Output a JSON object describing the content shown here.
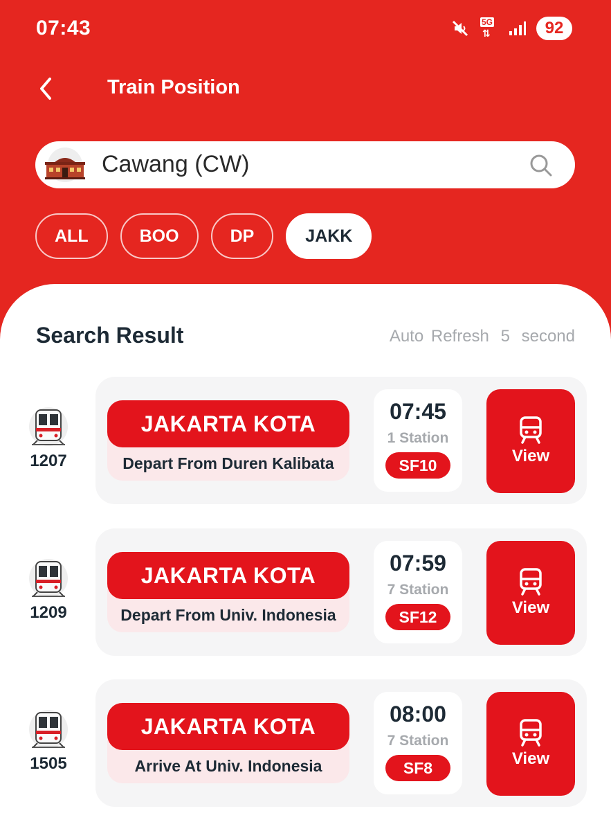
{
  "status_bar": {
    "time": "07:43",
    "network": "5G",
    "battery": "92"
  },
  "header": {
    "title": "Train Position"
  },
  "search": {
    "value": "Cawang (CW)"
  },
  "filters": [
    "ALL",
    "BOO",
    "DP",
    "JAKK"
  ],
  "active_filter": "JAKK",
  "results": {
    "title": "Search Result",
    "auto_refresh_label": "Auto Refresh",
    "auto_refresh_value": "5",
    "auto_refresh_unit": "second",
    "items": [
      {
        "train_no": "1207",
        "destination": "JAKARTA KOTA",
        "info": "Depart From Duren Kalibata",
        "time": "07:45",
        "stations": "1 Station",
        "platform": "SF10",
        "view_label": "View"
      },
      {
        "train_no": "1209",
        "destination": "JAKARTA KOTA",
        "info": "Depart From Univ. Indonesia",
        "time": "07:59",
        "stations": "7 Station",
        "platform": "SF12",
        "view_label": "View"
      },
      {
        "train_no": "1505",
        "destination": "JAKARTA KOTA",
        "info": "Arrive At Univ. Indonesia",
        "time": "08:00",
        "stations": "7 Station",
        "platform": "SF8",
        "view_label": "View"
      }
    ]
  },
  "colors": {
    "brand_red": "#e52620",
    "button_red": "#e3141c",
    "text_dark": "#1d2a35",
    "text_muted": "#a6a9ad"
  }
}
